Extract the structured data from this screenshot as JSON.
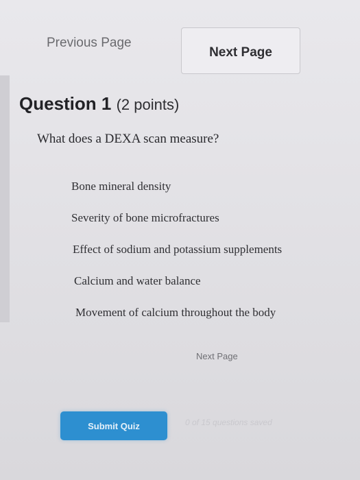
{
  "nav": {
    "previous_label": "Previous Page",
    "next_label": "Next Page"
  },
  "question": {
    "title": "Question 1",
    "points": "(2 points)",
    "text": "What does a DEXA scan measure?"
  },
  "answers": [
    "Bone mineral density",
    "Severity of bone microfractures",
    "Effect of sodium and potassium supplements",
    "Calcium and water balance",
    "Movement of calcium throughout the body"
  ],
  "footer": {
    "next_label": "Next Page",
    "submit_label": "Submit Quiz",
    "saved_status": "0 of 15 questions saved"
  },
  "colors": {
    "submit_button": "#2d8fd0",
    "background": "#e6e5e9"
  }
}
